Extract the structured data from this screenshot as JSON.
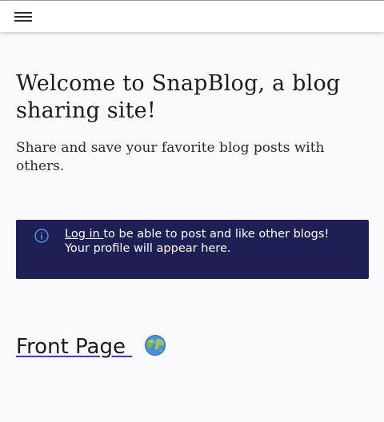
{
  "header": {
    "menu_icon": "hamburger-menu-icon"
  },
  "hero": {
    "title": "Welcome to SnapBlog, a blog sharing site!",
    "subtitle": "Share and save your favorite blog posts with others."
  },
  "info": {
    "icon": "info-circle-icon",
    "login_link": "Log in ",
    "line1_rest": " to be able to post and like other blogs!",
    "line2": "Your profile will appear here.",
    "background_color": "#1e1f55"
  },
  "front_page": {
    "label": "Front Page ",
    "icon": "globe-icon"
  }
}
